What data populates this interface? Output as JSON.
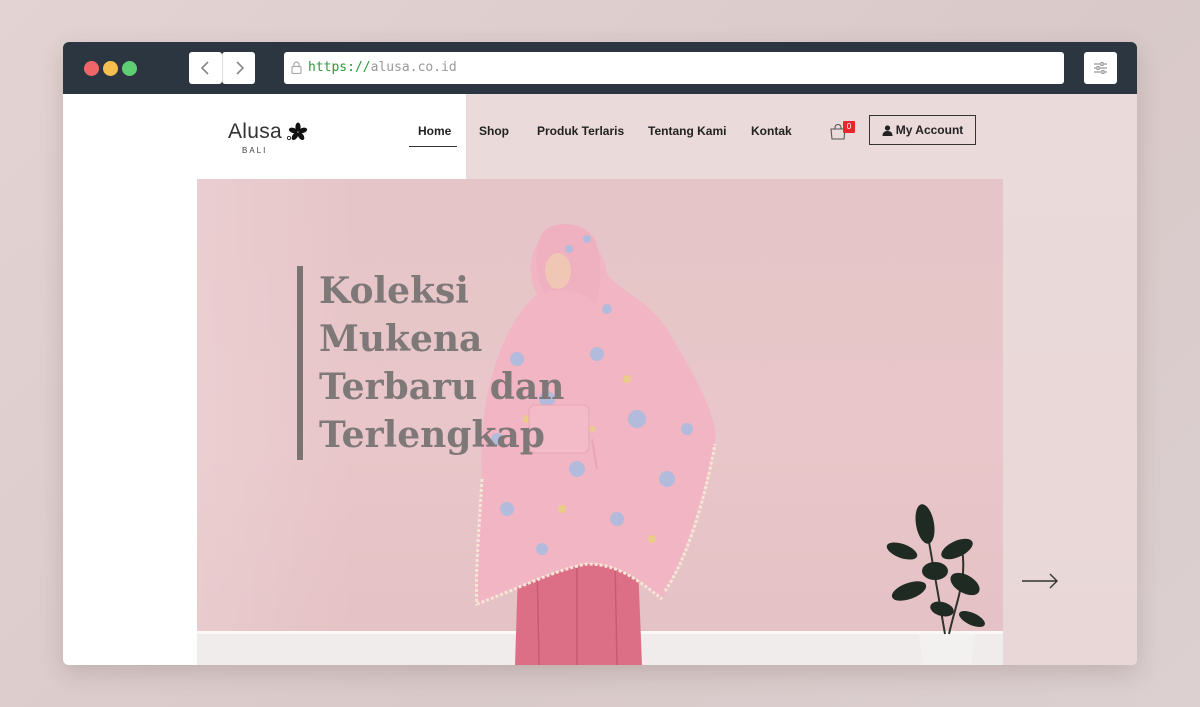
{
  "browser": {
    "url_scheme": "https://",
    "url_host": "alusa.co.id",
    "back_icon": "chevron-left-icon",
    "forward_icon": "chevron-right-icon",
    "settings_icon": "sliders-icon"
  },
  "header": {
    "logo_text": "Alusa",
    "logo_sub": "BALI",
    "nav": {
      "home": "Home",
      "shop": "Shop",
      "produk": "Produk Terlaris",
      "tentang": "Tentang Kami",
      "kontak": "Kontak"
    },
    "cart_count": "0",
    "account_label": "My Account"
  },
  "hero": {
    "headline": "Koleksi\nMukena\nTerbaru dan\nTerlengkap"
  },
  "colors": {
    "badge": "#e8262b",
    "hero_bg": "#e6c5c8",
    "headline": "#7f7878"
  }
}
